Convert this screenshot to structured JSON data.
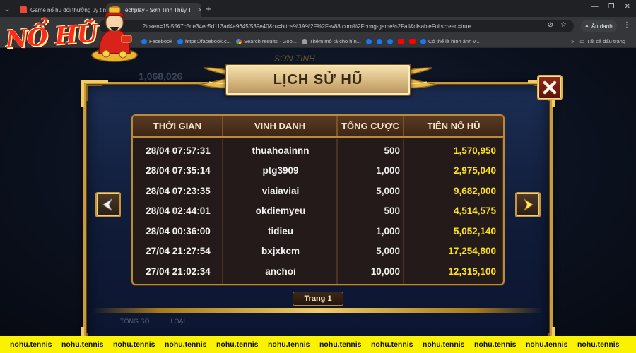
{
  "browser": {
    "tabs": [
      {
        "label": "Game nổ hũ đổi thưởng uy tín",
        "active": false
      },
      {
        "label": "Techplay - Sơn Tinh Thủy T",
        "active": true
      }
    ],
    "url": "...?token=15-5567c5de34ec5d113ad4a9645f539e40&ru=https%3A%2F%2Fsv88.com%2Fcong-game%2Fall&disableFullscreen=true",
    "incognito_label": "Ẩn danh",
    "bookmarks": [
      {
        "label": "Facebook",
        "icon": "facebook-icon"
      },
      {
        "label": "https://facebook.c...",
        "icon": "facebook-icon"
      },
      {
        "label": "Search results · Goo...",
        "icon": "google-icon"
      },
      {
        "label": "Thêm mô tả cho hìn...",
        "icon": "globe-icon"
      },
      {
        "label": "",
        "icon": "facebook-icon"
      },
      {
        "label": "",
        "icon": "facebook-icon"
      },
      {
        "label": "",
        "icon": "facebook-icon"
      },
      {
        "label": "",
        "icon": "youtube-icon"
      },
      {
        "label": "",
        "icon": "youtube-icon"
      },
      {
        "label": "Có thể là hình ảnh v...",
        "icon": "facebook-icon"
      }
    ],
    "all_bookmarks_label": "Tất cả dấu trang"
  },
  "logo": {
    "text": "NỔ HŨ"
  },
  "background": {
    "amount": "1,068,026",
    "title": "SƠN TINH"
  },
  "dialog": {
    "title": "LỊCH SỬ HŨ",
    "columns": [
      "THỜI GIAN",
      "VINH DANH",
      "TỔNG CƯỢC",
      "TIỀN NỔ HŨ"
    ],
    "rows": [
      {
        "time": "28/04 07:57:31",
        "name": "thuahoainnn",
        "bet": "500",
        "jackpot": "1,570,950"
      },
      {
        "time": "28/04 07:35:14",
        "name": "ptg3909",
        "bet": "1,000",
        "jackpot": "2,975,040"
      },
      {
        "time": "28/04 07:23:35",
        "name": "viaiaviai",
        "bet": "5,000",
        "jackpot": "9,682,000"
      },
      {
        "time": "28/04 02:44:01",
        "name": "okdiemyeu",
        "bet": "500",
        "jackpot": "4,514,575"
      },
      {
        "time": "28/04 00:36:00",
        "name": "tidieu",
        "bet": "1,000",
        "jackpot": "5,052,140"
      },
      {
        "time": "27/04 21:27:54",
        "name": "bxjxkcm",
        "bet": "5,000",
        "jackpot": "17,254,800"
      },
      {
        "time": "27/04 21:02:34",
        "name": "anchoi",
        "bet": "10,000",
        "jackpot": "12,315,100"
      }
    ],
    "page_label": "Trang 1"
  },
  "background_tags": [
    "TỔNG SỐ",
    "LOẠI"
  ],
  "ticker": {
    "text": "nohu.tennis",
    "repeat": 12
  },
  "colors": {
    "jackpot": "#ffe21a",
    "gold_border": "#c99b3a",
    "ticker_bg": "#fbf200",
    "frame_blue": "#1c2e55"
  }
}
